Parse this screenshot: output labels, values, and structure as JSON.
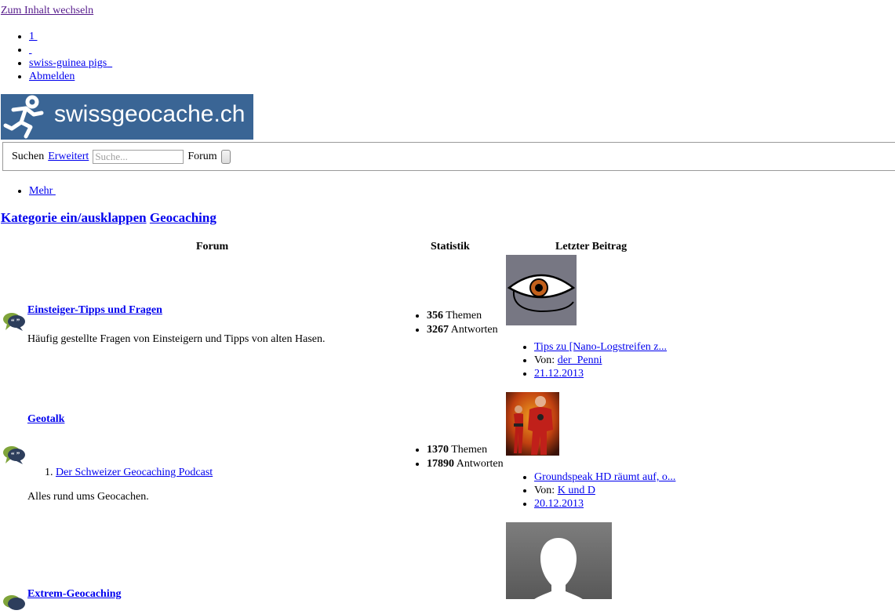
{
  "skip_link": "Zum Inhalt wechseln",
  "top_nav": {
    "items": [
      "1",
      "",
      "swiss-guinea pigs",
      "Abmelden"
    ]
  },
  "logo": {
    "text": "swissgeocache.ch",
    "bg_color": "#3a6595"
  },
  "search": {
    "label": "Suchen",
    "advanced_link": "Erweitert",
    "placeholder": "Suche...",
    "scope_label": "Forum"
  },
  "more_menu": {
    "label": "Mehr"
  },
  "category": {
    "toggle_label": "Kategorie ein/ausklappen",
    "title": "Geocaching"
  },
  "table_headers": {
    "forum": "Forum",
    "stats": "Statistik",
    "last_post": "Letzter Beitrag"
  },
  "forums": [
    {
      "title": "Einsteiger-Tipps und Fragen",
      "description": "Häufig gestellte Fragen von Einsteigern und Tipps von alten Hasen.",
      "subforums": [],
      "topics": "356",
      "topics_label": "Themen",
      "replies": "3267",
      "replies_label": "Antworten",
      "last_post": {
        "title": "Tips zu [Nano-Logstreifen z...",
        "by_label": "Von:",
        "author": "der_Penni",
        "date": "21.12.2013"
      },
      "avatar": "eye-avatar"
    },
    {
      "title": "Geotalk",
      "description": "Alles rund ums Geocachen.",
      "subforums": [
        "Der Schweizer Geocaching Podcast"
      ],
      "topics": "1370",
      "topics_label": "Themen",
      "replies": "17890",
      "replies_label": "Antworten",
      "last_post": {
        "title": "Groundspeak HD räumt auf, o...",
        "by_label": "Von:",
        "author": "K und D",
        "date": "20.12.2013"
      },
      "avatar": "superhero-avatar"
    },
    {
      "title": "Extrem-Geocaching",
      "avatar": "default-silhouette-avatar"
    }
  ]
}
